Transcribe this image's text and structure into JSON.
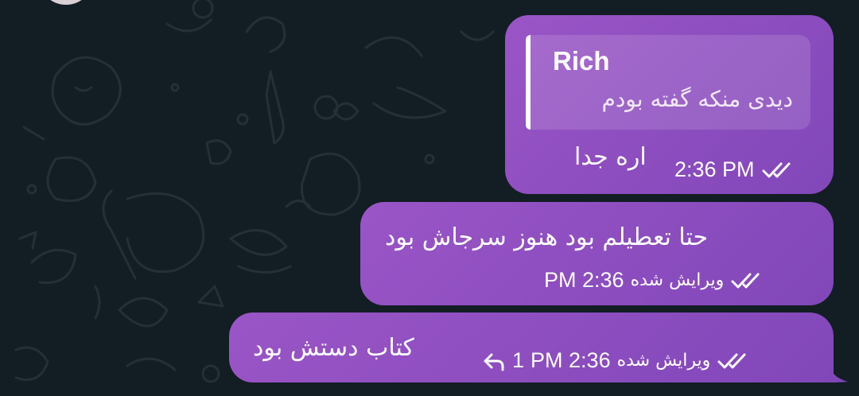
{
  "colors": {
    "background": "#131d24",
    "bubble_start": "#9a55c6",
    "bubble_end": "#8147b9",
    "text": "#ffffff"
  },
  "messages": [
    {
      "reply": {
        "name": "Rich",
        "text": "دیدی منکه گفته بودم"
      },
      "text": "اره جدا",
      "time": "2:36 PM",
      "status_icon": "double-check-icon"
    },
    {
      "text": "حتا تعطیلم بود هنوز سرجاش بود",
      "edited_label": "ویرایش شده",
      "time": "PM 2:36",
      "status_icon": "double-check-icon"
    },
    {
      "text": "کتاب دستش بود",
      "edited_label": "ویرایش شده",
      "time": "PM 2:36",
      "reply_count": "1",
      "reply_icon": "reply-arrow-icon",
      "status_icon": "double-check-icon"
    }
  ]
}
